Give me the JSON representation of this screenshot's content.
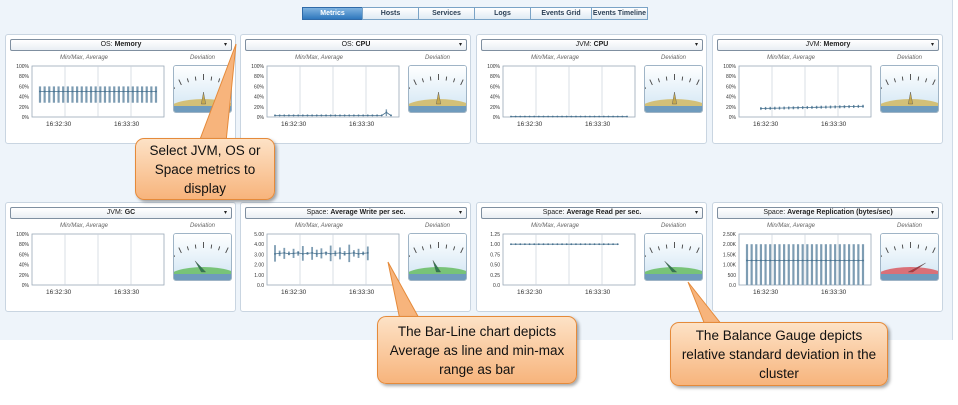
{
  "tabs": [
    {
      "label": "Metrics",
      "active": true
    },
    {
      "label": "Hosts",
      "active": false
    },
    {
      "label": "Services",
      "active": false
    },
    {
      "label": "Logs",
      "active": false
    },
    {
      "label": "Events Grid",
      "active": false
    },
    {
      "label": "Events Timeline",
      "active": false
    }
  ],
  "common": {
    "chart_caption": "Min/Max, Average",
    "gauge_caption": "Deviation",
    "arrow": "▾"
  },
  "panels": [
    {
      "prefix": "OS:",
      "metric": "Memory",
      "kind": "bars",
      "gauge": "tan",
      "ylim": [
        0,
        100
      ],
      "yticks": [
        "100%",
        "80%",
        "60%",
        "40%",
        "20%",
        "0%"
      ],
      "xticks": [
        "16:32:30",
        "16:33:30"
      ],
      "avg": 50,
      "lo": 28,
      "hi": 60,
      "gauge_level": 0.5
    },
    {
      "prefix": "OS:",
      "metric": "CPU",
      "kind": "low",
      "gauge": "tan",
      "ylim": [
        0,
        100
      ],
      "yticks": [
        "100%",
        "80%",
        "60%",
        "40%",
        "20%",
        "0%"
      ],
      "xticks": [
        "16:32:30",
        "16:33:30"
      ],
      "avg": 5,
      "lo": 3,
      "hi": 15,
      "gauge_level": 0.5
    },
    {
      "prefix": "JVM:",
      "metric": "CPU",
      "kind": "flat",
      "gauge": "tan",
      "ylim": [
        0,
        100
      ],
      "yticks": [
        "100%",
        "80%",
        "60%",
        "40%",
        "20%",
        "0%"
      ],
      "xticks": [
        "16:32:30",
        "16:33:30"
      ],
      "avg": 1,
      "lo": 0,
      "hi": 2,
      "gauge_level": 0.5
    },
    {
      "prefix": "JVM:",
      "metric": "Memory",
      "kind": "rising",
      "gauge": "tan",
      "ylim": [
        0,
        100
      ],
      "yticks": [
        "100%",
        "80%",
        "60%",
        "40%",
        "20%",
        "0%"
      ],
      "xticks": [
        "16:32:30",
        "16:33:30"
      ],
      "avg": 16,
      "lo": 12,
      "hi": 22,
      "gauge_level": 0.5
    },
    {
      "prefix": "JVM:",
      "metric": "GC",
      "kind": "empty",
      "gauge": "green",
      "ylim": [
        0,
        100
      ],
      "yticks": [
        "100%",
        "80%",
        "60%",
        "40%",
        "20%",
        "0%"
      ],
      "xticks": [
        "16:32:30",
        "16:33:30"
      ],
      "gauge_level": 0.38
    },
    {
      "prefix": "Space:",
      "metric": "Average Write per sec.",
      "kind": "spiky",
      "gauge": "green",
      "ylim": [
        0,
        5
      ],
      "yticks": [
        "5.00",
        "4.00",
        "3.00",
        "2.00",
        "1.00",
        "0.0"
      ],
      "xticks": [
        "16:32:30",
        "16:33:30"
      ],
      "avg": 3.1,
      "lo": 2.3,
      "hi": 4.0,
      "gauge_level": 0.42
    },
    {
      "prefix": "Space:",
      "metric": "Average Read per sec.",
      "kind": "constant",
      "gauge": "green",
      "ylim": [
        0,
        1.25
      ],
      "yticks": [
        "1.25",
        "1.00",
        "0.75",
        "0.50",
        "0.25",
        "0.0"
      ],
      "xticks": [
        "16:32:30",
        "16:33:30"
      ],
      "avg": 1.0,
      "lo": 1.0,
      "hi": 1.0,
      "gauge_level": 0.36
    },
    {
      "prefix": "Space:",
      "metric": "Average Replication (bytes/sec)",
      "kind": "tallbars",
      "gauge": "red",
      "ylim": [
        0,
        2500
      ],
      "yticks": [
        "2.50K",
        "2.00K",
        "1.50K",
        "1.00K",
        "500",
        "0.0"
      ],
      "xticks": [
        "16:32:30",
        "16:33:30"
      ],
      "avg": 1200,
      "lo": 0,
      "hi": 2000,
      "gauge_level": 0.72
    }
  ],
  "callouts": [
    {
      "text": "Select JVM, OS or Space metrics to display"
    },
    {
      "text": "The Bar-Line chart depicts Average as line and min-max range as bar"
    },
    {
      "text": "The Balance Gauge depicts relative standard deviation in the cluster"
    }
  ],
  "colors": {
    "bar": "#7e9db3",
    "avg": "#4a7390",
    "tan": "#d2bb6a",
    "green": "#6dbf6a",
    "red": "#d9636a",
    "callout": "#f7b47c"
  }
}
